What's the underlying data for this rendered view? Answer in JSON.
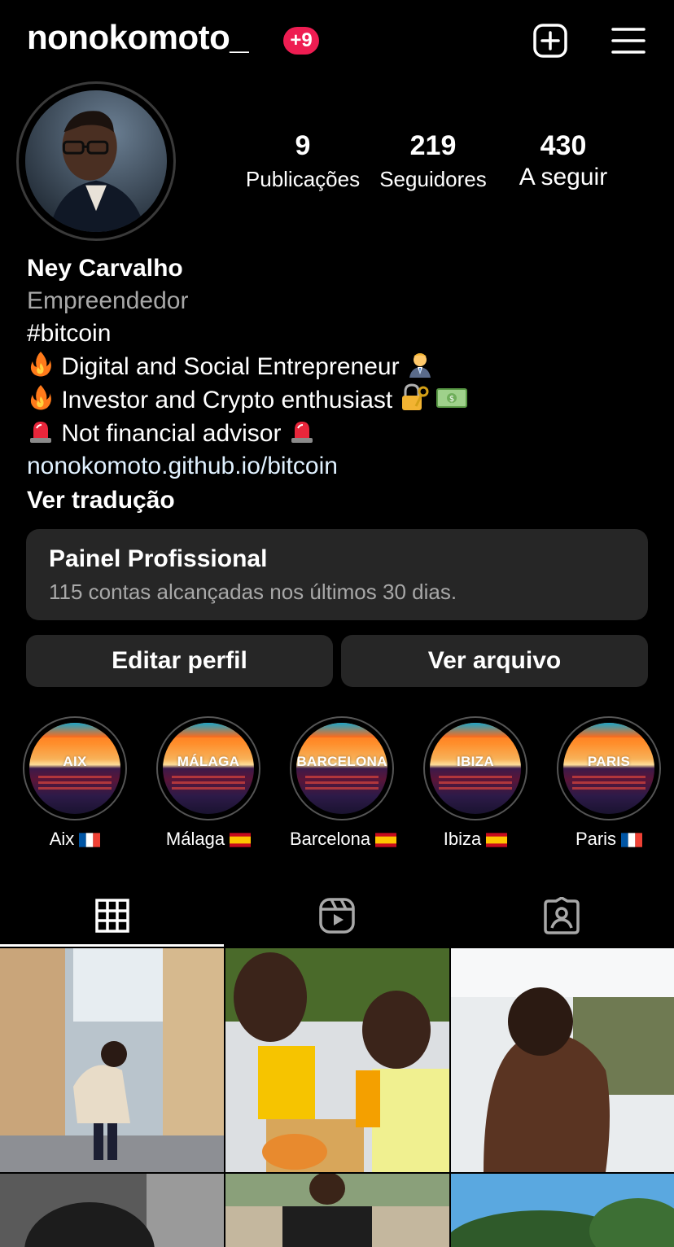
{
  "header": {
    "username": "nonokomoto_",
    "notification_badge": "+9",
    "icons": [
      "plus-square-icon",
      "hamburger-menu-icon"
    ]
  },
  "profile": {
    "stats": [
      {
        "value": "9",
        "label": "Publicações"
      },
      {
        "value": "219",
        "label": "Seguidores"
      },
      {
        "value": "430",
        "label": "A seguir"
      }
    ],
    "name": "Ney Carvalho",
    "category": "Empreendedor",
    "bio_lines": [
      "#bitcoin",
      "Digital and Social Entrepreneur",
      "Investor and Crypto enthusiast",
      "Not financial advisor"
    ],
    "link": "nonokomoto.github.io/bitcoin",
    "translate": "Ver tradução"
  },
  "professional_panel": {
    "title": "Painel Profissional",
    "subtitle": "115 contas alcançadas nos últimos 30 dias."
  },
  "buttons": {
    "edit": "Editar perfil",
    "archive": "Ver arquivo"
  },
  "highlights": [
    {
      "cover": "AIX",
      "label": "Aix"
    },
    {
      "cover": "MÁLAGA",
      "label": "Málaga"
    },
    {
      "cover": "BARCELONA",
      "label": "Barcelona"
    },
    {
      "cover": "IBIZA",
      "label": "Ibiza"
    },
    {
      "cover": "PARIS",
      "label": "Paris"
    }
  ],
  "tabs": [
    "grid-icon",
    "reels-icon",
    "tagged-icon"
  ],
  "colors": {
    "background": "#000000",
    "surface": "#262626",
    "badge": "#ee1d52",
    "muted_text": "#a8a8a8",
    "link": "#e0f1ff"
  }
}
